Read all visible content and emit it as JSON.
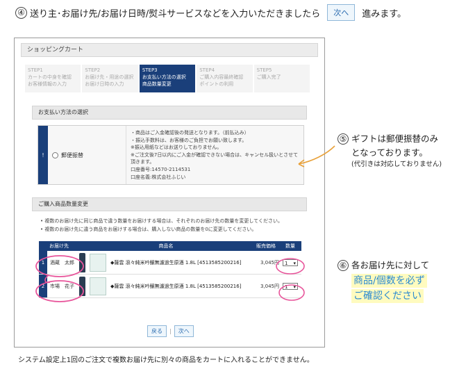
{
  "instruction": {
    "num": "④",
    "text": "送り主･お届け先/お届け日時/熨斗サービスなどを入力いただきましたら",
    "button": "次へ",
    "suffix": "進みます。"
  },
  "cart": {
    "title": "ショッピングカート",
    "steps": [
      {
        "label": "STEP1",
        "line1": "カートの中身を確認",
        "line2": "お客様情報の入力"
      },
      {
        "label": "STEP2",
        "line1": "お届け先・用途の選択",
        "line2": "お届け日時の入力"
      },
      {
        "label": "STEP3",
        "line1": "お支払い方法の選択",
        "line2": "商品数量変更"
      },
      {
        "label": "STEP4",
        "line1": "ご購入内容最終確認",
        "line2": "ポイントの利用"
      },
      {
        "label": "STEP5",
        "line1": "ご購入完了",
        "line2": ""
      }
    ],
    "payment": {
      "section_title": "お支払い方法の選択",
      "marker": "!",
      "option": "郵便振替",
      "info": [
        "・商品はご入金確認後の発送となります。（前払込み）",
        "・振込手数料は、お客様のご負担でお願い致します。",
        "※振込用紙などはお送りしておりません。",
        "※ご注文後7日以内にご入金が確認できない場合は、キャンセル扱いとさせて頂きます。",
        "口座番号:14570-2114531",
        "口座名義:株式会社ふじい"
      ]
    },
    "quantity": {
      "section_title": "ご購入商品数量変更",
      "notes": [
        "複数のお届け先に同じ商品で違う数量をお届けする場合は、それぞれのお届け先の数量を変更してください。",
        "複数のお届け先に違う商品をお届けする場合は、購入しない商品の数量を0に変更してください。"
      ],
      "headers": [
        "お届け先",
        "商品名",
        "販売価格",
        "数量"
      ],
      "rows": [
        {
          "num": "1",
          "dest": "酒蔵　太郎",
          "product": "◆薩雲 滾々純米吟醸無濾過生原酒 1.8L [4513585200216]",
          "price": "3,045円",
          "qty": "1"
        },
        {
          "num": "2",
          "dest": "市場　花子",
          "product": "◆薩雲 滾々純米吟醸無濾過生原酒 1.8L [4513585200216]",
          "price": "3,045円",
          "qty": "1"
        }
      ]
    },
    "back_button": "戻る",
    "separator": "|",
    "next_button": "次へ"
  },
  "footnote": "システム設定上1回のご注文で複数お届け先に別々の商品をカートに入れることができません。",
  "callout5": {
    "num": "⑤",
    "line1": "ギフトは郵便振替のみ",
    "line2": "となっております。",
    "line3": "(代引きは対応しておりません)"
  },
  "callout6": {
    "num": "⑥",
    "line1": "各お届け先に対して",
    "line2": "商品/個数を必ず",
    "line3": "ご確認ください"
  },
  "colors": {
    "accent_navy": "#1a3f7a",
    "annotation_orange": "#e8a13a",
    "annotation_pink": "#e8559b",
    "highlight_blue": "#2a8ad1",
    "highlight_bg": "#fffbbf"
  }
}
